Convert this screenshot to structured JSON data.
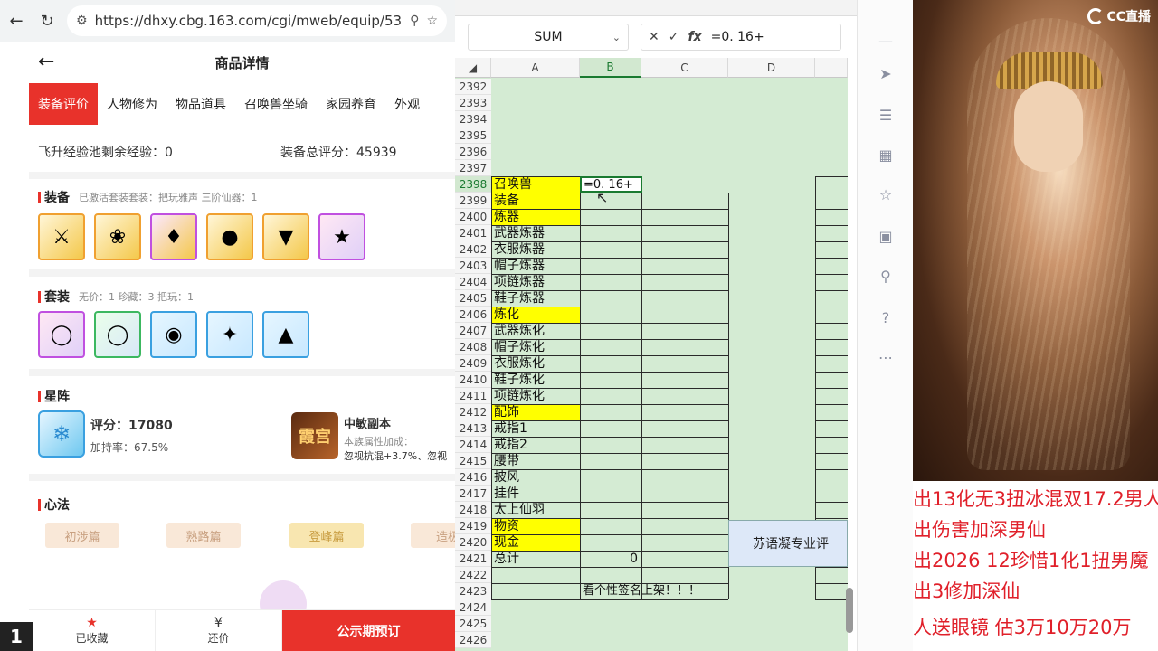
{
  "browser": {
    "url": "https://dhxy.cbg.163.com/cgi/mweb/equip/53...",
    "back_icon": "back-arrow-icon",
    "reload_icon": "reload-icon",
    "search_icon": "search-icon",
    "page_number": "1"
  },
  "page": {
    "title": "商品详情",
    "tabs": [
      "装备评价",
      "人物修为",
      "物品道具",
      "召唤兽坐骑",
      "家园养育",
      "外观"
    ],
    "active_tab": 0,
    "feisheng_label": "飞升经验池剩余经验：0",
    "equip_score_label": "装备总评分：45939",
    "equip_section": {
      "title": "装备",
      "sub": "已激活套装套装：把玩雅声   三阶仙器：1"
    },
    "suit_section": {
      "title": "套装",
      "sub": "无价：1   珍藏：3   把玩：1"
    },
    "star_section": {
      "title": "星阵",
      "score_label": "评分：17080",
      "bonus_label": "加持率：67.5%",
      "copy_title": "中敏副本",
      "copy_sub": "本族属性加成：",
      "copy_desc": "忽视抗混+3.7%、忽视",
      "copy_icon_text": "霞宫"
    },
    "xinfa_section": {
      "title": "心法",
      "buttons": [
        "初涉篇",
        "熟路篇",
        "登峰篇",
        "造极"
      ]
    },
    "bottom": {
      "fav_label": "已收藏",
      "bargain_label": "还价",
      "cta_label": "公示期预订"
    }
  },
  "sheet": {
    "namebox": "SUM",
    "formula": "=0. 16+",
    "columns": [
      "A",
      "B",
      "C",
      "D"
    ],
    "rows": [
      {
        "n": "2392",
        "a": "",
        "y": false
      },
      {
        "n": "2393",
        "a": "",
        "y": false
      },
      {
        "n": "2394",
        "a": "",
        "y": false
      },
      {
        "n": "2395",
        "a": "",
        "y": false
      },
      {
        "n": "2396",
        "a": "",
        "y": false
      },
      {
        "n": "2397",
        "a": "",
        "y": false
      },
      {
        "n": "2398",
        "a": "召唤兽",
        "y": true
      },
      {
        "n": "2399",
        "a": "装备",
        "y": true
      },
      {
        "n": "2400",
        "a": "炼器",
        "y": true
      },
      {
        "n": "2401",
        "a": "武器炼器",
        "y": false
      },
      {
        "n": "2402",
        "a": "衣服炼器",
        "y": false
      },
      {
        "n": "2403",
        "a": "帽子炼器",
        "y": false
      },
      {
        "n": "2404",
        "a": "项链炼器",
        "y": false
      },
      {
        "n": "2405",
        "a": "鞋子炼器",
        "y": false
      },
      {
        "n": "2406",
        "a": "炼化",
        "y": true
      },
      {
        "n": "2407",
        "a": "武器炼化",
        "y": false
      },
      {
        "n": "2408",
        "a": "帽子炼化",
        "y": false
      },
      {
        "n": "2409",
        "a": "衣服炼化",
        "y": false
      },
      {
        "n": "2410",
        "a": "鞋子炼化",
        "y": false
      },
      {
        "n": "2411",
        "a": "项链炼化",
        "y": false
      },
      {
        "n": "2412",
        "a": "配饰",
        "y": true
      },
      {
        "n": "2413",
        "a": "戒指1",
        "y": false
      },
      {
        "n": "2414",
        "a": "戒指2",
        "y": false
      },
      {
        "n": "2415",
        "a": "腰带",
        "y": false
      },
      {
        "n": "2416",
        "a": "披风",
        "y": false
      },
      {
        "n": "2417",
        "a": "挂件",
        "y": false
      },
      {
        "n": "2418",
        "a": "太上仙羽",
        "y": false
      },
      {
        "n": "2419",
        "a": "物资",
        "y": true
      },
      {
        "n": "2420",
        "a": "现金",
        "y": true
      },
      {
        "n": "2421",
        "a": "总计",
        "y": false
      },
      {
        "n": "2422",
        "a": "",
        "y": false
      },
      {
        "n": "2423",
        "a": "",
        "y": false
      },
      {
        "n": "2424",
        "a": "",
        "y": false
      },
      {
        "n": "2425",
        "a": "",
        "y": false
      },
      {
        "n": "2426",
        "a": "",
        "y": false
      }
    ],
    "active_cell_text": "=0. 16+",
    "total_value": "0",
    "note_text": "看个性签名上架！！！",
    "su_box_text": "苏语凝专业评"
  },
  "stream": {
    "brand": "CC直播",
    "lines": [
      "出13化无3扭冰混双17.2男人",
      "出伤害加深男仙",
      "出2026 12珍惜1化1扭男魔",
      "出3修加深仙",
      "人送眼镜  估3万10万20万"
    ]
  },
  "colors": {
    "accent": "#e8322b",
    "sheet_green": "#d4ebd3",
    "highlight_yellow": "#ffff00",
    "ticker_red": "#e0202a"
  }
}
